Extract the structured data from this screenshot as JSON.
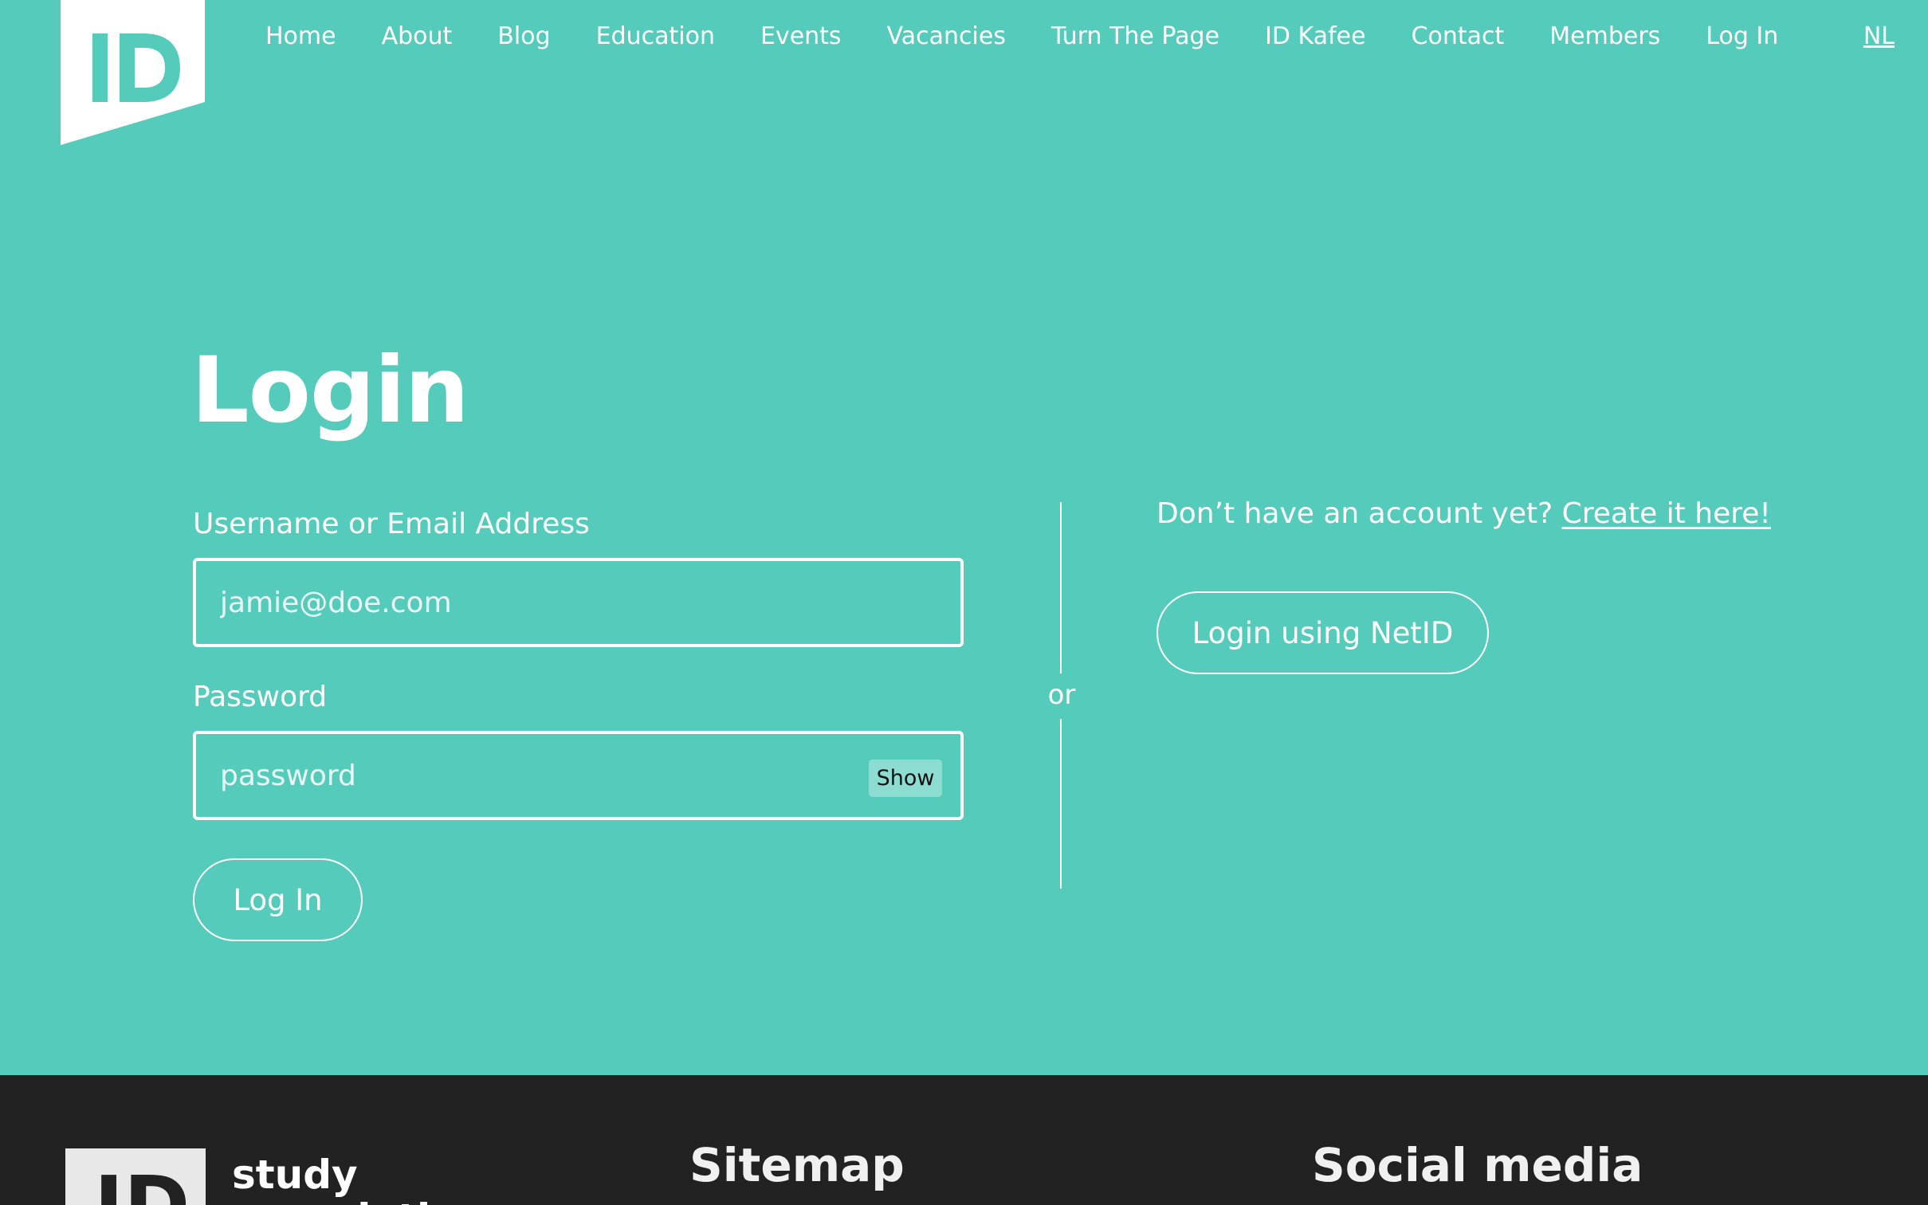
{
  "header": {
    "logo_text": "ID",
    "nav": [
      {
        "label": "Home"
      },
      {
        "label": "About"
      },
      {
        "label": "Blog"
      },
      {
        "label": "Education"
      },
      {
        "label": "Events"
      },
      {
        "label": "Vacancies"
      },
      {
        "label": "Turn The Page"
      },
      {
        "label": "ID Kafee"
      },
      {
        "label": "Contact"
      },
      {
        "label": "Members"
      },
      {
        "label": "Log In"
      }
    ],
    "language": "NL"
  },
  "main": {
    "title": "Login",
    "username_label": "Username or Email Address",
    "username_placeholder": "jamie@doe.com",
    "password_label": "Password",
    "password_placeholder": "password",
    "show_label": "Show",
    "login_button": "Log In",
    "divider": "or",
    "signup_prompt": "Don’t have an account yet?",
    "signup_link": "Create it here!",
    "netid_button": "Login using NetID"
  },
  "footer": {
    "logo_text": "ID",
    "brand_line1": "study",
    "brand_line2": "association",
    "sitemap_heading": "Sitemap",
    "social_heading": "Social media"
  },
  "colors": {
    "accent": "#55ccbb",
    "footer_bg": "#222222",
    "text": "#ffffff"
  }
}
